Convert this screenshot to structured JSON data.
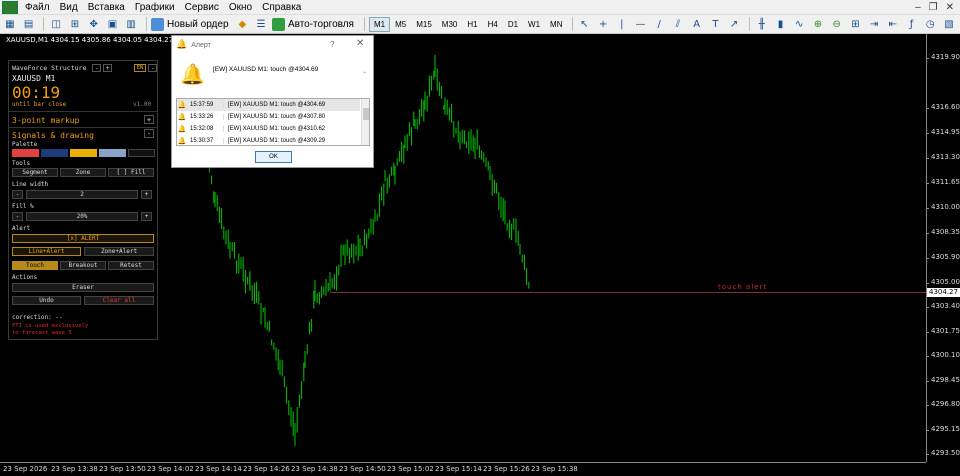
{
  "menubar": {
    "items": [
      "Файл",
      "Вид",
      "Вставка",
      "Графики",
      "Сервис",
      "Окно",
      "Справка"
    ],
    "window_controls": [
      "–",
      "❐",
      "✕"
    ]
  },
  "toolbar": {
    "new_order": "Новый ордер",
    "autotrade": "Авто-торговля",
    "timeframes": [
      "M1",
      "M5",
      "M15",
      "M30",
      "H1",
      "H4",
      "D1",
      "W1",
      "MN"
    ],
    "active_timeframe": "M1"
  },
  "chart": {
    "symbol_line": "XAUUSD,M1  4304.15 4305.86 4304.05 4304.27",
    "current_price": "4304.27",
    "price_labels": [
      "4319.90",
      "4316.60",
      "4314.95",
      "4313.30",
      "4311.65",
      "4310.00",
      "4308.35",
      "4305.90",
      "4305.00",
      "4303.40",
      "4301.75",
      "4300.10",
      "4298.45",
      "4296.80",
      "4295.15",
      "4293.50"
    ],
    "time_labels": [
      "23 Sep 2026",
      "23 Sep 13:38",
      "23 Sep 13:50",
      "23 Sep 14:02",
      "23 Sep 14:14",
      "23 Sep 14:26",
      "23 Sep 14:38",
      "23 Sep 14:50",
      "23 Sep 15:02",
      "23 Sep 15:14",
      "23 Sep 15:26",
      "23 Sep 15:38"
    ],
    "alert_line_label": "touch alert",
    "colors": {
      "bull": "#00c800",
      "bear": "#00c800",
      "alert_line": "#7a3040"
    }
  },
  "panel": {
    "title": "WaveForce Structure",
    "minus": "-",
    "plus": "+",
    "lang": "EN",
    "symbol": "XAUUSD  M1",
    "timer": "00:19",
    "until_bar": "until bar close",
    "version": "v1.00",
    "section_markup": "3-point markup",
    "section_signals": "Signals & drawing",
    "palette_label": "Palette",
    "palette": [
      "#e04040",
      "#1f3a7a",
      "#e8b000",
      "#8aa4c8",
      "#111111"
    ],
    "tools_label": "Tools",
    "tools": [
      "Segment",
      "Zone",
      "[ ] Fill"
    ],
    "line_width_label": "Line width",
    "line_width": "2",
    "fill_label": "Fill %",
    "fill_value": "20%",
    "alert_label": "Alert",
    "alert_toggle": "[x] ALERT",
    "alert_modes": [
      "Line+Alert",
      "Zone+Alert"
    ],
    "alert_types": [
      "Touch",
      "Breakout",
      "Retest"
    ],
    "actions_label": "Actions",
    "eraser": "Eraser",
    "undo": "Undo",
    "clear_all": "Clear all",
    "correction": "correction: --",
    "note_lines": [
      "FTI is used exclusively",
      "to forecast wave 5"
    ]
  },
  "dialog": {
    "title": "Алерт",
    "help": "?",
    "close": "✕",
    "message": "[EW] XAUUSD M1: touch @4304.69",
    "rows": [
      {
        "time": "15:37:59",
        "msg": "[EW] XAUUSD M1: touch @4304.69"
      },
      {
        "time": "15:33:26",
        "msg": "[EW] XAUUSD M1: touch @4307.80"
      },
      {
        "time": "15:32:08",
        "msg": "[EW] XAUUSD M1: touch @4310.62"
      },
      {
        "time": "15:30:37",
        "msg": "[EW] XAUUSD M1: touch @4309.29"
      }
    ],
    "ok": "OK"
  }
}
